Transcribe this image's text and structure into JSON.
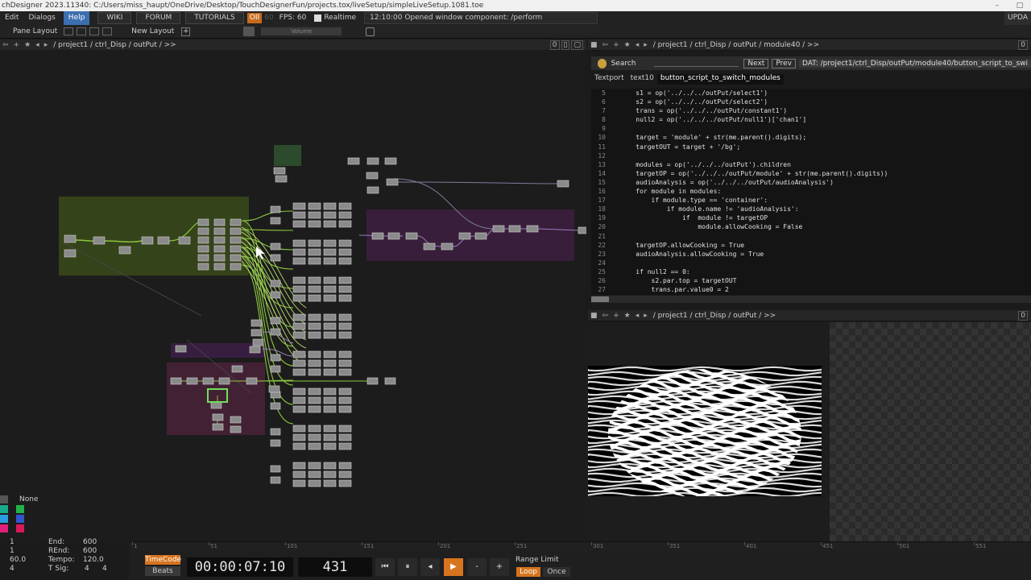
{
  "window": {
    "title": "chDesigner 2023.11340: C:/Users/miss_haupt/OneDrive/Desktop/TouchDesignerFun/projects.tox/liveSetup/simpleLiveSetup.1081.toe",
    "controls": [
      "–",
      "□",
      "✕"
    ]
  },
  "menu": {
    "edit": "Edit",
    "dialogs": "Dialogs",
    "help": "Help",
    "wiki": "WIKI",
    "forum": "FORUM",
    "tutorials": "TUTORIALS",
    "oii": "OII",
    "sixty": "60",
    "fps": "FPS:  60",
    "realtime": "Realtime",
    "message": "12:10:00 Opened window component: /perform",
    "update": "UPDA"
  },
  "layoutbar": {
    "pane_layout": "Pane Layout",
    "new_layout": "New Layout",
    "plus": "+",
    "volume": "Volume"
  },
  "network_pane": {
    "path": "/ project1 / ctrl_Disp / outPut / >>",
    "badge": "0"
  },
  "code_pane": {
    "path": "/ project1 / ctrl_Disp / outPut / module40 / >>",
    "badge": "0",
    "search_label": "Search",
    "next": "Next",
    "prev": "Prev",
    "dat_path": "DAT:  /project1/ctrl_Disp/outPut/module40/button_script_to_swi",
    "tabs": [
      "Textport",
      "text10",
      "button_script_to_switch_modules"
    ],
    "lines": [
      {
        "n": "5",
        "t": "    s1 = op('../../../outPut/select1')"
      },
      {
        "n": "6",
        "t": "    s2 = op('../../../outPut/select2')"
      },
      {
        "n": "7",
        "t": "    trans = op('../../../outPut/constant1')"
      },
      {
        "n": "8",
        "t": "    null2 = op('../../../outPut/null1')['chan1']"
      },
      {
        "n": "9",
        "t": ""
      },
      {
        "n": "10",
        "t": "    target = 'module' + str(me.parent().digits);"
      },
      {
        "n": "11",
        "t": "    targetOUT = target + '/bg';"
      },
      {
        "n": "12",
        "t": ""
      },
      {
        "n": "13",
        "t": "    modules = op('../../../outPut').children"
      },
      {
        "n": "14",
        "t": "    targetOP = op('../../../outPut/module' + str(me.parent().digits))"
      },
      {
        "n": "15",
        "t": "    audioAnalysis = op('../../../outPut/audioAnalysis')"
      },
      {
        "n": "16",
        "t": "    for module in modules:"
      },
      {
        "n": "17",
        "t": "        if module.type == 'container':"
      },
      {
        "n": "18",
        "t": "            if module.name != 'audioAnalysis':"
      },
      {
        "n": "19",
        "t": "                if  module != targetOP"
      },
      {
        "n": "20",
        "t": "                    module.allowCooking = False"
      },
      {
        "n": "21",
        "t": ""
      },
      {
        "n": "22",
        "t": "    targetOP.allowCooking = True"
      },
      {
        "n": "23",
        "t": "    audioAnalysis.allowCooking = True"
      },
      {
        "n": "24",
        "t": ""
      },
      {
        "n": "25",
        "t": "    if null2 == 0:"
      },
      {
        "n": "26",
        "t": "        s2.par.top = targetOUT"
      },
      {
        "n": "27",
        "t": "        trans.par.value0 = 2"
      }
    ]
  },
  "viewer_pane": {
    "path": "/ project1 / ctrl_Disp / outPut / >>",
    "badge": "0"
  },
  "palette": {
    "none_label": "None",
    "colors": [
      "#1aa88a",
      "#22b24c",
      "#2a9be0",
      "#3355cc",
      "#e0207a",
      "#d8185a"
    ]
  },
  "timeline": {
    "ticks": [
      "1",
      "51",
      "101",
      "151",
      "201",
      "251",
      "301",
      "351",
      "401",
      "451",
      "501",
      "551"
    ]
  },
  "time_settings": {
    "start_val": "1",
    "rstart_val": "1",
    "rate_val": "60.0",
    "tsig_val": "4",
    "end_label": "End:",
    "end_val": "600",
    "rend_label": "REnd:",
    "rend_val": "600",
    "tempo_label": "Tempo:",
    "tempo_val": "120.0",
    "tsig_label": "T Sig:",
    "tsig_a": "4",
    "tsig_b": "4"
  },
  "transport": {
    "timecode": "TimeCode",
    "beats": "Beats",
    "clock": "00:00:07:10",
    "frame": "431",
    "rewind": "⏮",
    "pause": "⏸",
    "step_back": "◂",
    "play": "▶",
    "minus": "-",
    "plus": "+",
    "range_limit": "Range Limit",
    "loop": "Loop",
    "once": "Once"
  },
  "colors": {
    "accent_orange": "#d7741e",
    "help_blue": "#3c6fb0",
    "group_green": "#3a4a1a",
    "group_purple": "#3d1f3f",
    "group_pink": "#4a2238",
    "wire_green": "#8cc63f"
  }
}
